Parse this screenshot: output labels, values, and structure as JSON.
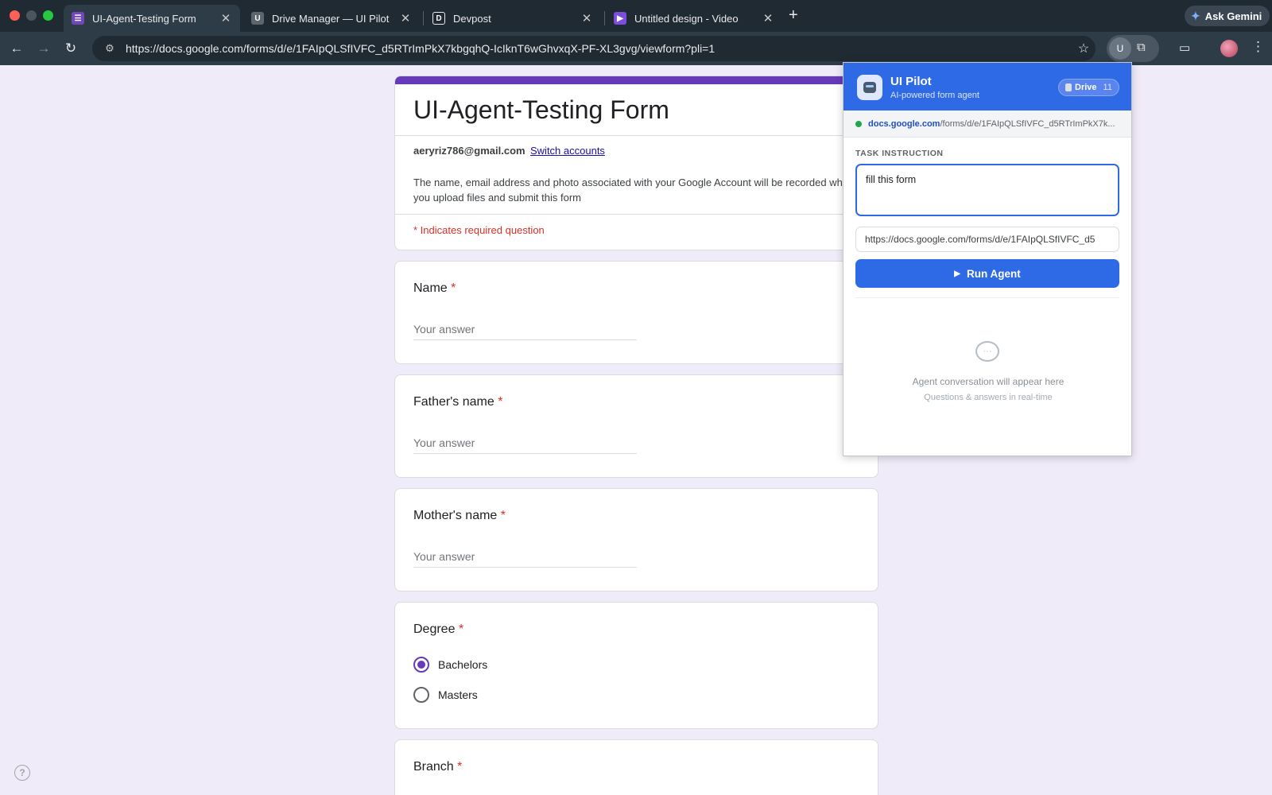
{
  "browser": {
    "tabs": [
      {
        "title": "UI-Agent-Testing Form",
        "favicon": "forms-icon",
        "active": true
      },
      {
        "title": "Drive Manager — UI Pilot",
        "favicon": "U",
        "active": false
      },
      {
        "title": "Devpost",
        "favicon": "D",
        "active": false
      },
      {
        "title": "Untitled design - Video",
        "favicon": "video-icon",
        "active": false
      }
    ],
    "new_tab": "+",
    "gemini_label": "Ask Gemini",
    "url": "https://docs.google.com/forms/d/e/1FAIpQLSfIVFC_d5RTrImPkX7kbgqhQ-IcIknT6wGhvxqX-PF-XL3gvg/viewform?pli=1",
    "extension_avatar": "U"
  },
  "form": {
    "accent_color": "#673ab7",
    "title": "UI-Agent-Testing Form",
    "account_email": "aeryriz786@gmail.com",
    "switch_accounts": "Switch accounts",
    "notice": "The name, email address and photo associated with your Google Account will be recorded when you upload files and submit this form",
    "required_note": "* Indicates required question",
    "questions": [
      {
        "title": "Name",
        "required_mark": "*",
        "placeholder": "Your answer"
      },
      {
        "title": "Father's name",
        "required_mark": "*",
        "placeholder": "Your answer"
      },
      {
        "title": "Mother's name",
        "required_mark": "*",
        "placeholder": "Your answer"
      },
      {
        "title": "Degree",
        "required_mark": "*",
        "options": [
          "Bachelors",
          "Masters"
        ],
        "selected": "Bachelors"
      },
      {
        "title": "Branch",
        "required_mark": "*"
      }
    ],
    "help_icon": "?"
  },
  "extension": {
    "brand_color": "#2f6ae6",
    "name": "UI Pilot",
    "subtitle": "AI-powered form agent",
    "badge_label": "Drive",
    "badge_count": "11",
    "site_domain": "docs.google.com",
    "site_path": "/forms/d/e/1FAIpQLSfIVFC_d5RTrImPkX7k...",
    "task_label": "TASK INSTRUCTION",
    "task_value": "fill this form",
    "url_value": "https://docs.google.com/forms/d/e/1FAIpQLSfIVFC_d5",
    "run_label": "Run Agent",
    "empty_title": "Agent conversation will appear here",
    "empty_sub": "Questions & answers in real-time"
  }
}
